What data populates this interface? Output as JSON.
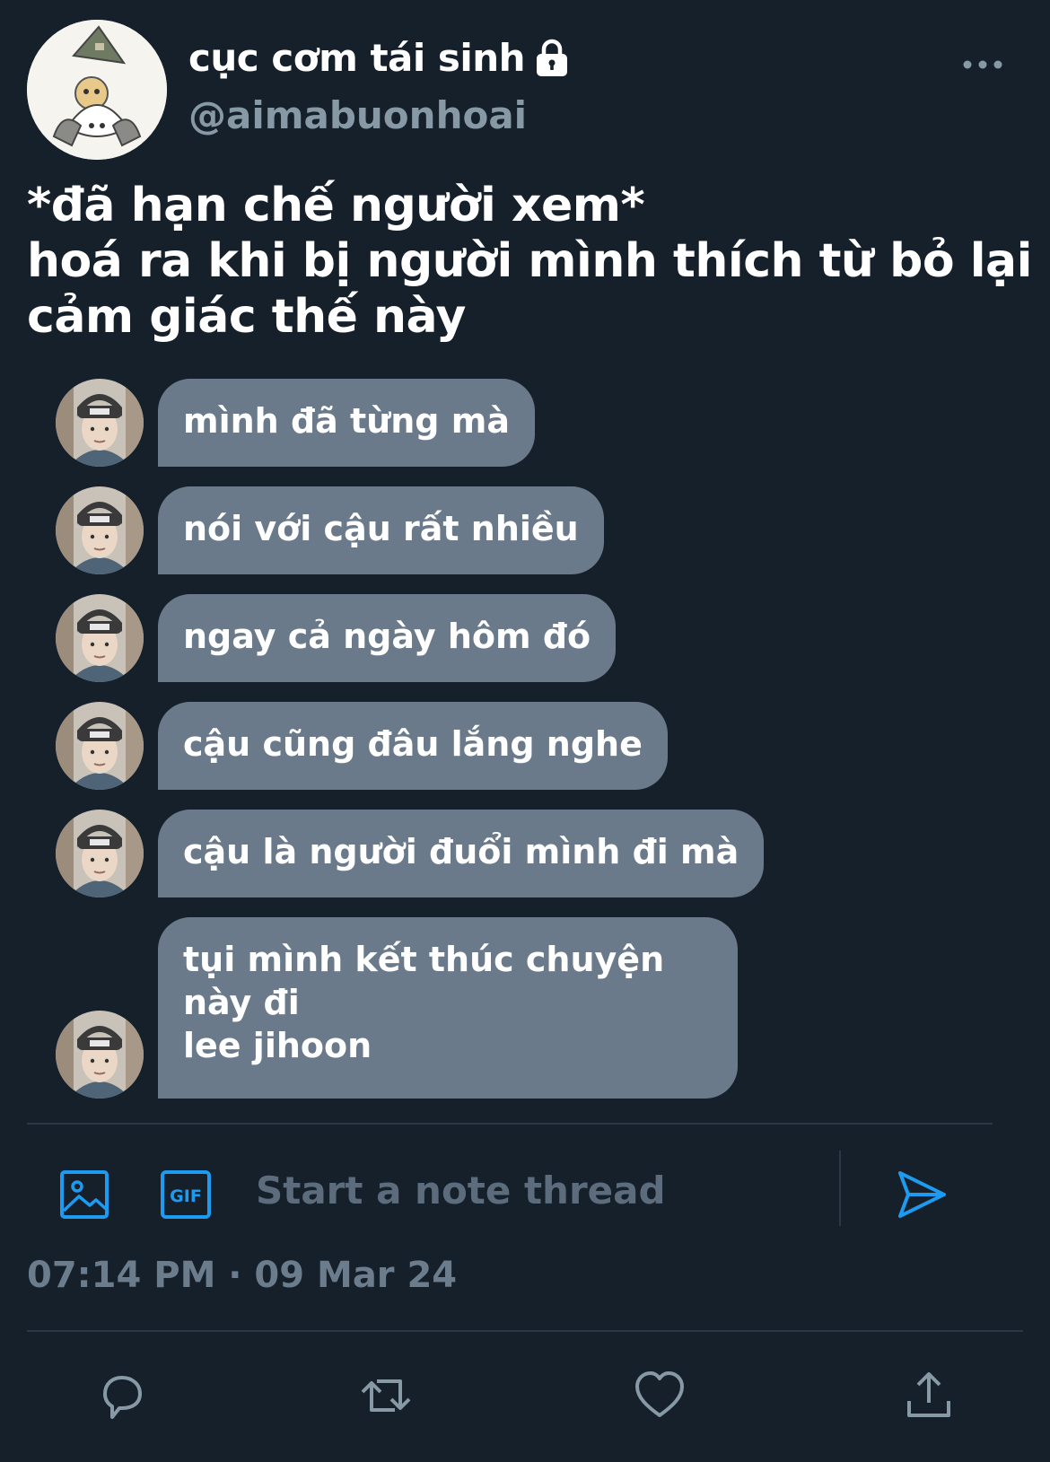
{
  "profile": {
    "display_name": "cục cơm tái sinh",
    "handle": "@aimabuonhoai",
    "protected_icon": "lock-icon",
    "more_icon": "more-horizontal-icon"
  },
  "tweet": {
    "text": "*đã hạn chế người xem*\nhoá ra khi bị người mình thích từ bỏ lại\ncảm giác thế này"
  },
  "messages": [
    {
      "text": "mình đã từng mà"
    },
    {
      "text": "nói với cậu rất nhiều"
    },
    {
      "text": "ngay cả ngày hôm đó"
    },
    {
      "text": "cậu cũng đâu lắng nghe"
    },
    {
      "text": "cậu là người đuổi mình đi mà"
    },
    {
      "text": "tụi mình kết thúc chuyện này đi\nlee jihoon"
    }
  ],
  "note_bar": {
    "image_icon": "image-icon",
    "gif_icon": "gif-icon",
    "gif_label": "GIF",
    "placeholder": "Start a note thread",
    "send_icon": "send-icon"
  },
  "timestamp": "07:14 PM · 09 Mar 24",
  "actions": {
    "reply_icon": "reply-icon",
    "retweet_icon": "retweet-icon",
    "like_icon": "heart-icon",
    "share_icon": "share-icon"
  },
  "colors": {
    "background": "#16202b",
    "bubble": "#6b7a8b",
    "accent": "#1d9bf0",
    "secondary_text": "#8899a6"
  }
}
